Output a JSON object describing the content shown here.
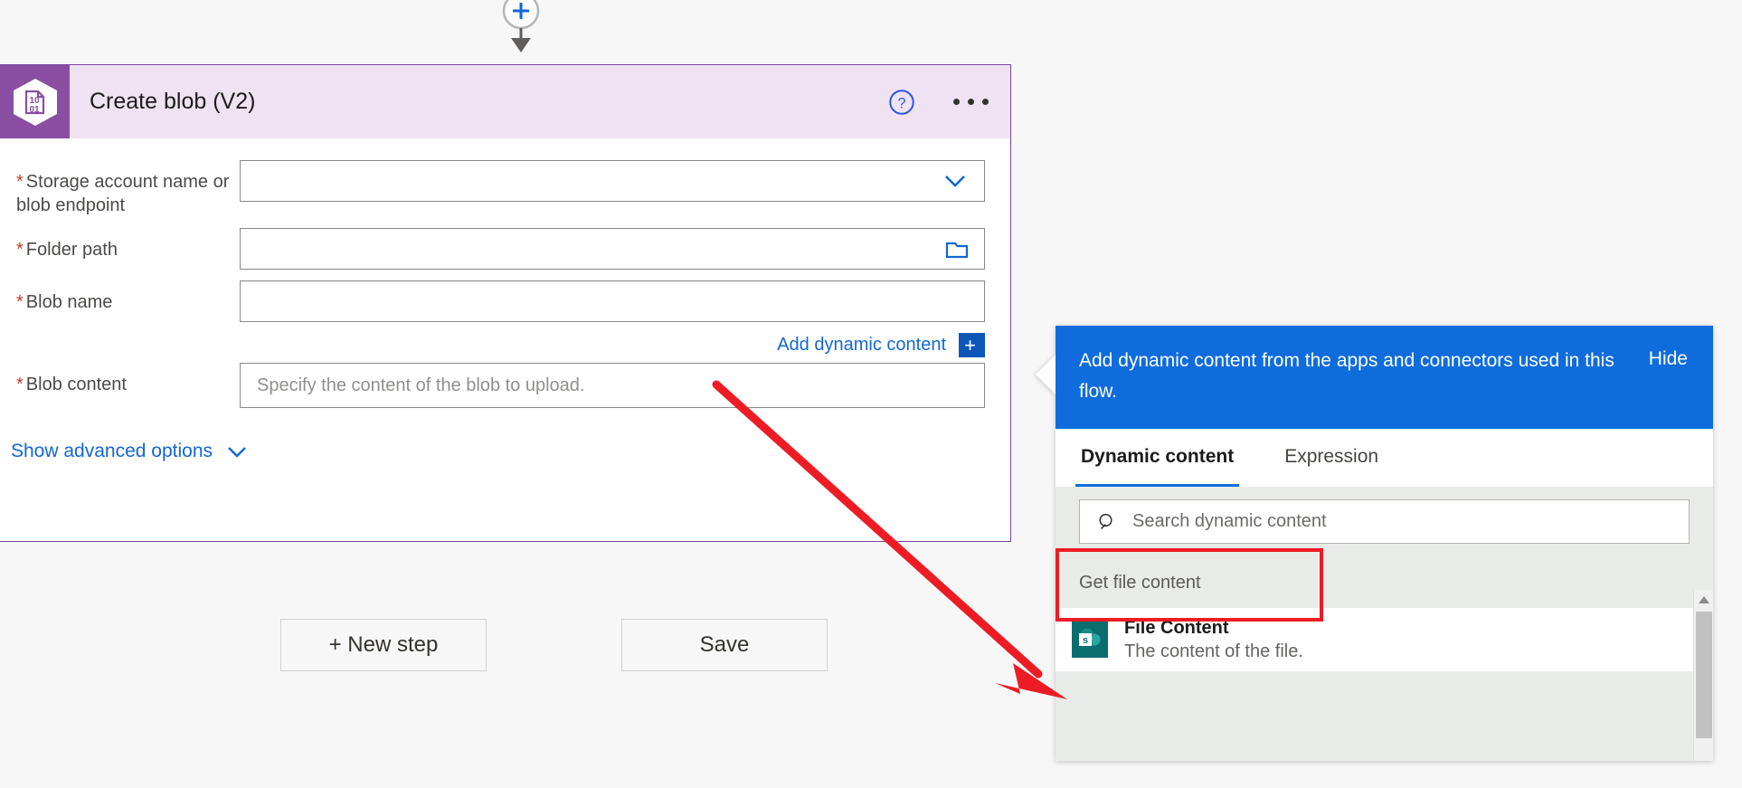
{
  "connector": {
    "add_icon": "plus-circle-icon",
    "arrow_icon": "arrow-down-icon"
  },
  "action_card": {
    "title": "Create blob (V2)",
    "icon": "azure-blob-storage-icon",
    "icon_text_top": "10",
    "icon_text_bottom": "01",
    "help_icon": "help-circle-icon",
    "more_icon": "ellipsis-icon",
    "accent_color": "#8a4fa3",
    "header_bg": "#efe3f3",
    "fields": [
      {
        "label": "Storage account name or blob endpoint",
        "required_marker": "*",
        "value": "",
        "placeholder": "",
        "icon": "chevron-down-icon"
      },
      {
        "label": "Folder path",
        "required_marker": "*",
        "value": "",
        "placeholder": "",
        "icon": "folder-icon"
      },
      {
        "label": "Blob name",
        "required_marker": "*",
        "value": "",
        "placeholder": "",
        "icon": ""
      },
      {
        "label": "Blob content",
        "required_marker": "*",
        "value": "",
        "placeholder": "Specify the content of the blob to upload.",
        "icon": ""
      }
    ],
    "add_dynamic_content_label": "Add dynamic content",
    "add_dynamic_content_plus": "+",
    "show_advanced_label": "Show advanced options",
    "show_advanced_icon": "chevron-down-icon",
    "link_color": "#1267d6"
  },
  "buttons": [
    {
      "label": "+ New step",
      "name": "new-step-button"
    },
    {
      "label": "Save",
      "name": "save-button"
    }
  ],
  "dynamic_panel": {
    "banner_text": "Add dynamic content from the apps and connectors used in this flow.",
    "hide_label": "Hide",
    "banner_color": "#0f6cdd",
    "tabs": [
      {
        "label": "Dynamic content",
        "active": true
      },
      {
        "label": "Expression",
        "active": false
      }
    ],
    "search_placeholder": "Search dynamic content",
    "search_value": "",
    "search_icon": "search-icon",
    "groups": [
      {
        "header": "Get file content",
        "items": [
          {
            "title": "File Content",
            "subtitle": "The content of the file.",
            "icon": "sharepoint-icon",
            "highlighted": true
          }
        ]
      }
    ],
    "scroll_up_icon": "caret-up-icon",
    "highlight_color": "#ed1c24"
  },
  "annotation": {
    "arrow_color": "#ed1c24",
    "arrow_icon": "red-pointer-arrow"
  }
}
